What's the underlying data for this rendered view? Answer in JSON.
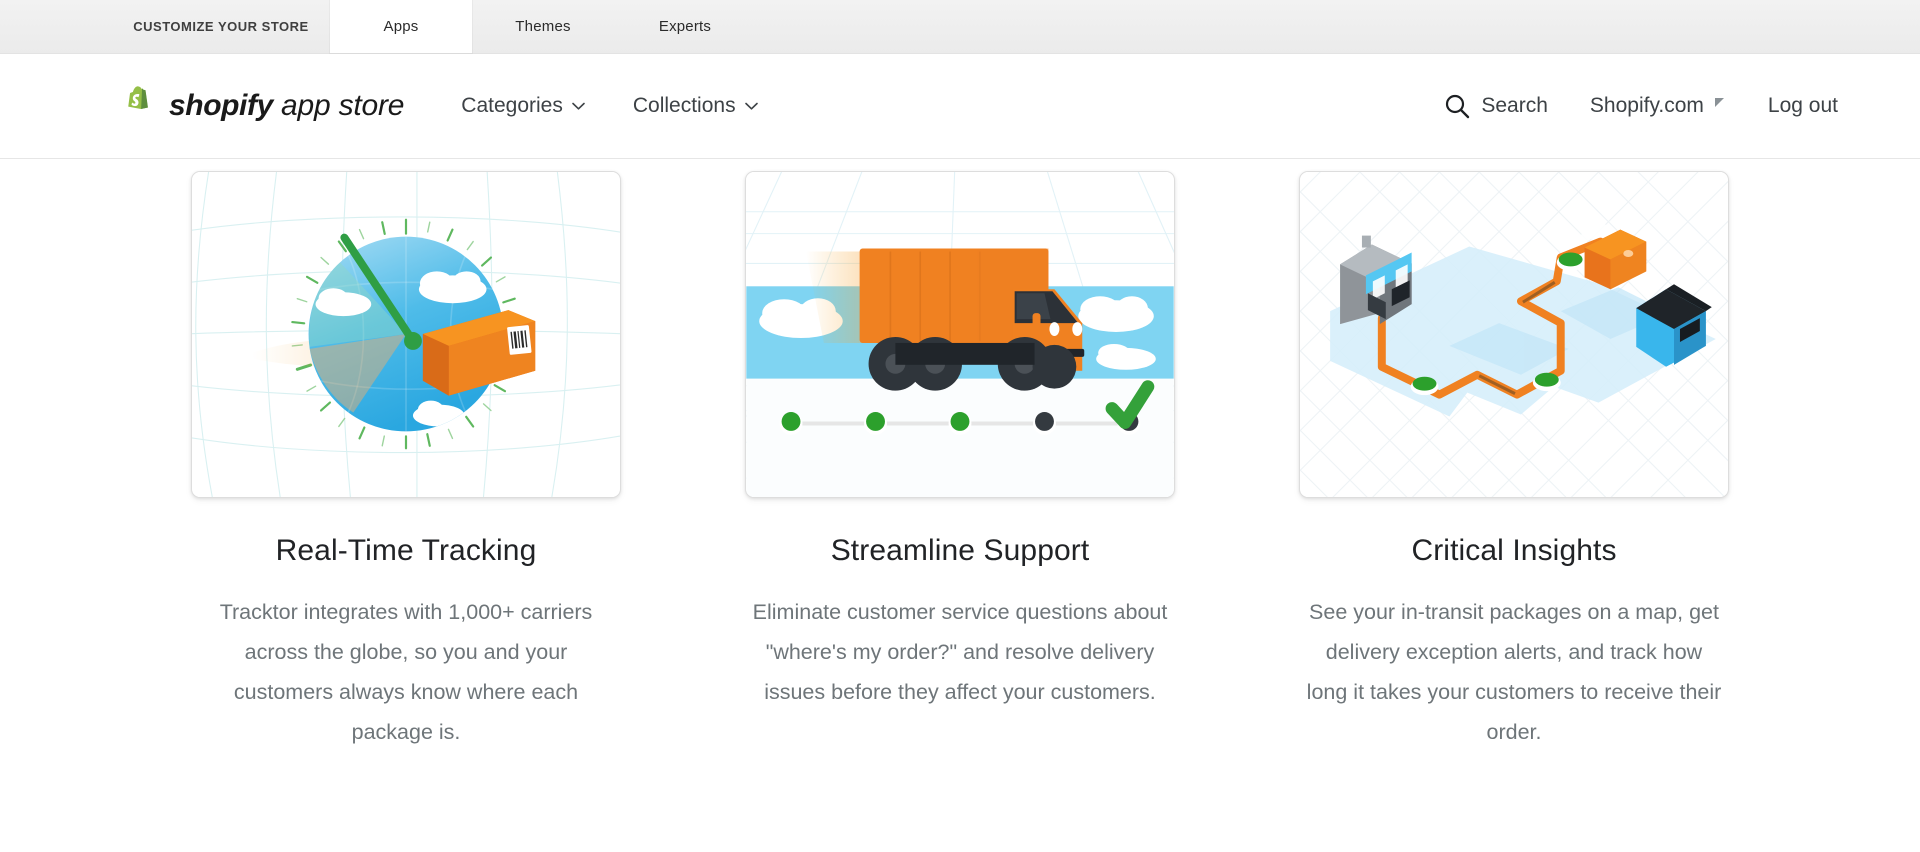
{
  "admin_bar": {
    "tabs": [
      {
        "label": "CUSTOMIZE YOUR STORE",
        "active": false
      },
      {
        "label": "Apps",
        "active": true
      },
      {
        "label": "Themes",
        "active": false
      },
      {
        "label": "Experts",
        "active": false
      }
    ]
  },
  "header": {
    "logo_icon": "shopify-bag-icon",
    "brand_bold": "shopify",
    "brand_light": " app store",
    "nav": [
      {
        "label": "Categories",
        "icon": "chevron-down-icon"
      },
      {
        "label": "Collections",
        "icon": "chevron-down-icon"
      }
    ],
    "right": {
      "search_label": "Search",
      "search_icon": "search-icon",
      "account_label": "Shopify.com",
      "account_icon": "caret-icon",
      "logout_label": "Log out"
    }
  },
  "features": [
    {
      "illustration": "globe-speedometer-package-illustration",
      "title": "Real-Time Tracking",
      "body": "Tracktor integrates with 1,000+ carriers across the globe, so you and your customers always know where each package is."
    },
    {
      "illustration": "delivery-truck-progress-illustration",
      "title": "Streamline Support",
      "body": "Eliminate customer service questions about \"where's my order?\" and resolve delivery issues before they affect your customers."
    },
    {
      "illustration": "isometric-route-map-illustration",
      "title": "Critical Insights",
      "body": "See your in-transit packages on a map, get delivery exception alerts, and track how long it takes your customers to receive their order."
    }
  ],
  "colors": {
    "brand_green": "#95bf47",
    "accent_orange": "#f08121",
    "status_green": "#2ca02c",
    "sky_blue": "#7ed2f0",
    "text_dark": "#212326",
    "text_muted": "#6e7579"
  }
}
